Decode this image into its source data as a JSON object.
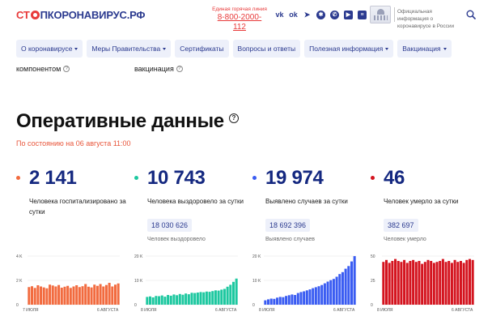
{
  "header": {
    "logo": {
      "a": "СТ",
      "b": "ПКОРОНАВИРУС.РФ"
    },
    "hotline_label": "Единая горячая линия",
    "hotline_phone": "8-800-2000-112",
    "socials": [
      {
        "icon": "vk-icon",
        "glyph": "vk"
      },
      {
        "icon": "odnoklassniki-icon",
        "glyph": "ok"
      },
      {
        "icon": "telegram-icon",
        "glyph": "➤"
      },
      {
        "icon": "ok-round-icon",
        "glyph": "✱"
      },
      {
        "icon": "viber-icon",
        "glyph": "✆"
      },
      {
        "icon": "youtube-icon",
        "glyph": "▶"
      },
      {
        "icon": "vimeo-icon",
        "glyph": "≡"
      }
    ],
    "official_text": "Официальная информация о коронавирусе в России"
  },
  "nav": [
    {
      "label": "О коронавирусе",
      "caret": true
    },
    {
      "label": "Меры Правительства",
      "caret": true
    },
    {
      "label": "Сертификаты",
      "caret": false
    },
    {
      "label": "Вопросы и ответы",
      "caret": false
    },
    {
      "label": "Полезная информация",
      "caret": true
    },
    {
      "label": "Вакцинация",
      "caret": true
    }
  ],
  "cutrow": {
    "left": "компонентом",
    "right": "вакцинация"
  },
  "section": {
    "title": "Оперативные данные",
    "asof": "По состоянию на 06 августа 11:00"
  },
  "cards": [
    {
      "value": "2 141",
      "desc": "Человека госпитализировано за сутки",
      "total": "",
      "total_label": "",
      "color": "#f26b3f",
      "chart_data": {
        "type": "bar",
        "y_ticks": [
          "4 K",
          "2 K",
          "0"
        ],
        "ylim": [
          0,
          4000
        ],
        "x_labels": [
          "7 ИЮЛЯ",
          "6 АВГУСТА"
        ],
        "values": [
          1450,
          1520,
          1380,
          1600,
          1500,
          1420,
          1350,
          1650,
          1580,
          1500,
          1620,
          1400,
          1480,
          1550,
          1380,
          1500,
          1600,
          1450,
          1520,
          1700,
          1480,
          1420,
          1650,
          1550,
          1700,
          1500,
          1620,
          1800,
          1500,
          1650,
          1750
        ]
      }
    },
    {
      "value": "10 743",
      "desc": "Человека выздоровело за сутки",
      "total": "18 030 626",
      "total_label": "Человек выздоровело",
      "color": "#1ec8a0",
      "chart_data": {
        "type": "bar",
        "y_ticks": [
          "20 K",
          "10 K",
          "0"
        ],
        "ylim": [
          0,
          20000
        ],
        "x_labels": [
          "8 ИЮЛЯ",
          "6 АВГУСТА"
        ],
        "values": [
          3200,
          3400,
          3000,
          3600,
          3500,
          3800,
          3300,
          4000,
          3700,
          4200,
          3900,
          4400,
          4100,
          4600,
          4300,
          4900,
          4800,
          5000,
          5200,
          5100,
          5400,
          5300,
          5600,
          5900,
          5800,
          6200,
          6500,
          7400,
          8200,
          9400,
          10743
        ]
      }
    },
    {
      "value": "19 974",
      "desc": "Выявлено случаев за сутки",
      "total": "18 692 396",
      "total_label": "Выявлено случаев",
      "color": "#3a5cf2",
      "chart_data": {
        "type": "bar",
        "y_ticks": [
          "20 K",
          "10 K",
          "0"
        ],
        "ylim": [
          0,
          20000
        ],
        "x_labels": [
          "8 ИЮЛЯ",
          "6 АВГУСТА"
        ],
        "values": [
          1800,
          2200,
          2500,
          2400,
          2900,
          3200,
          3100,
          3600,
          3900,
          4200,
          4000,
          4800,
          5200,
          5500,
          5900,
          6300,
          6800,
          7200,
          7600,
          8100,
          8800,
          9500,
          10100,
          10600,
          11500,
          12600,
          13400,
          14800,
          15900,
          17800,
          19974
        ]
      }
    },
    {
      "value": "46",
      "desc": "Человек умерло за сутки",
      "total": "382 697",
      "total_label": "Человек умерло",
      "color": "#d4141f",
      "chart_data": {
        "type": "bar",
        "y_ticks": [
          "50",
          "25",
          "0"
        ],
        "ylim": [
          0,
          50
        ],
        "x_labels": [
          "8 ИЮЛЯ",
          "6 АВГУСТА"
        ],
        "values": [
          44,
          46,
          43,
          45,
          47,
          45,
          44,
          46,
          43,
          45,
          46,
          44,
          45,
          42,
          44,
          46,
          45,
          43,
          44,
          45,
          47,
          44,
          45,
          43,
          46,
          44,
          45,
          43,
          46,
          47,
          46
        ]
      }
    }
  ]
}
